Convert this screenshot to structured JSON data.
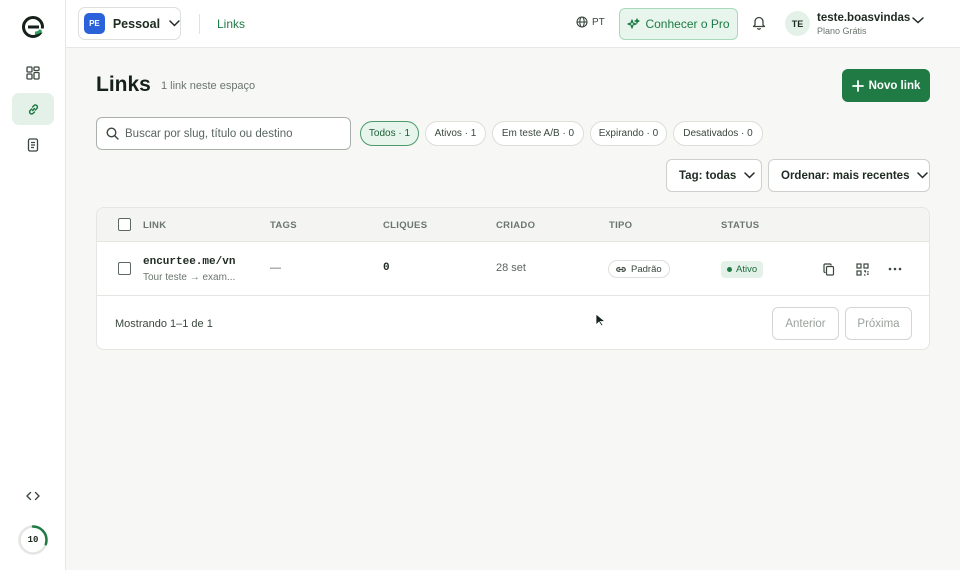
{
  "sidebar": {
    "items": [
      {
        "name": "dashboard",
        "icon": "grid-icon",
        "active": false
      },
      {
        "name": "links",
        "icon": "link-icon",
        "active": true
      },
      {
        "name": "documents",
        "icon": "document-icon",
        "active": false
      }
    ],
    "dev_icon": "code-icon",
    "usage_value": "10",
    "usage_fraction": 0.3
  },
  "topbar": {
    "workspace_badge": "PE",
    "workspace_name": "Pessoal",
    "breadcrumb": "Links",
    "language": "PT",
    "pro_button": "Conhecer o Pro",
    "user_initials": "TE",
    "user_name": "teste.boasvindas",
    "user_plan": "Plano Grátis"
  },
  "page": {
    "title": "Links",
    "subtitle": "1 link neste espaço",
    "new_button": "Novo link"
  },
  "search": {
    "placeholder": "Buscar por slug, título ou destino",
    "value": ""
  },
  "filters": [
    {
      "label": "Todos · 1",
      "active": true
    },
    {
      "label": "Ativos · 1",
      "active": false
    },
    {
      "label": "Em teste A/B · 0",
      "active": false
    },
    {
      "label": "Expirando · 0",
      "active": false
    },
    {
      "label": "Desativados · 0",
      "active": false
    }
  ],
  "tag_select": "Tag: todas",
  "sort_select": "Ordenar: mais recentes",
  "table": {
    "columns": [
      "LINK",
      "TAGS",
      "CLIQUES",
      "CRIADO",
      "TIPO",
      "STATUS"
    ],
    "rows": [
      {
        "slug": "encurtee.me/vn\\",
        "destination": "Tour teste → exam...",
        "tags": "—",
        "clicks": "0",
        "created": "28 set",
        "type": "Padrão",
        "status": "Ativo"
      }
    ]
  },
  "pagination": {
    "summary": "Mostrando 1–1 de 1",
    "prev": "Anterior",
    "next": "Próxima"
  },
  "colors": {
    "accent": "#1f7a44",
    "workspace": "#2b62d9"
  }
}
